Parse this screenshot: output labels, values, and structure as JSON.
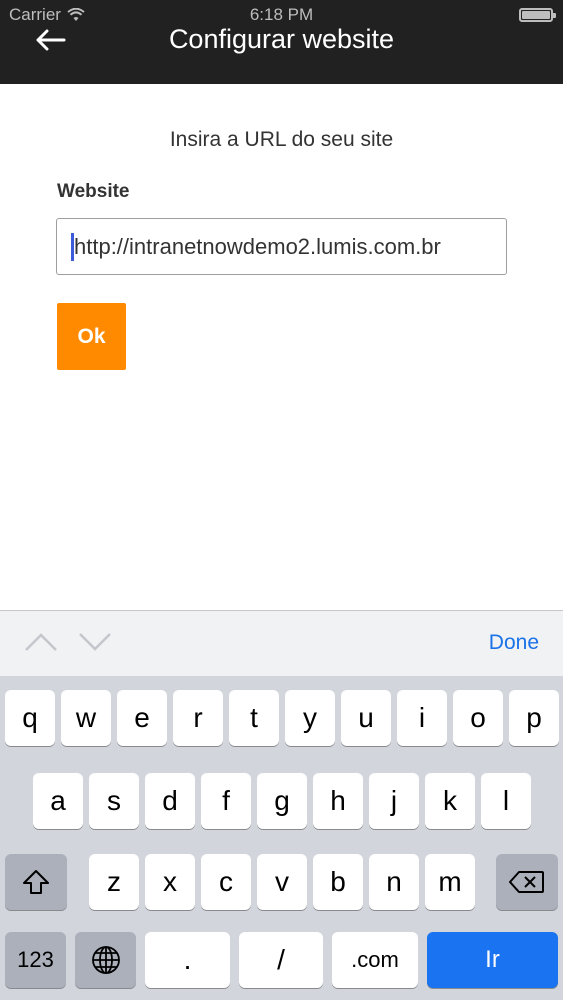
{
  "status_bar": {
    "carrier": "Carrier",
    "time": "6:18 PM"
  },
  "header": {
    "title": "Configurar website",
    "back_icon": "arrow-left-icon"
  },
  "content": {
    "prompt": "Insira a URL do seu site",
    "field_label": "Website",
    "url_value": "http://intranetnowdemo2.lumis.com.br",
    "ok_label": "Ok"
  },
  "accessory": {
    "done_label": "Done"
  },
  "keyboard": {
    "row1": [
      "q",
      "w",
      "e",
      "r",
      "t",
      "y",
      "u",
      "i",
      "o",
      "p"
    ],
    "row2": [
      "a",
      "s",
      "d",
      "f",
      "g",
      "h",
      "j",
      "k",
      "l"
    ],
    "row3": [
      "z",
      "x",
      "c",
      "v",
      "b",
      "n",
      "m"
    ],
    "row4": {
      "numbers": "123",
      "slash": "/",
      "dot": ".",
      "com": ".com",
      "go": "Ir"
    }
  },
  "colors": {
    "accent": "#ff8a00",
    "header_bg": "#212121",
    "link_blue": "#1a73e8"
  }
}
